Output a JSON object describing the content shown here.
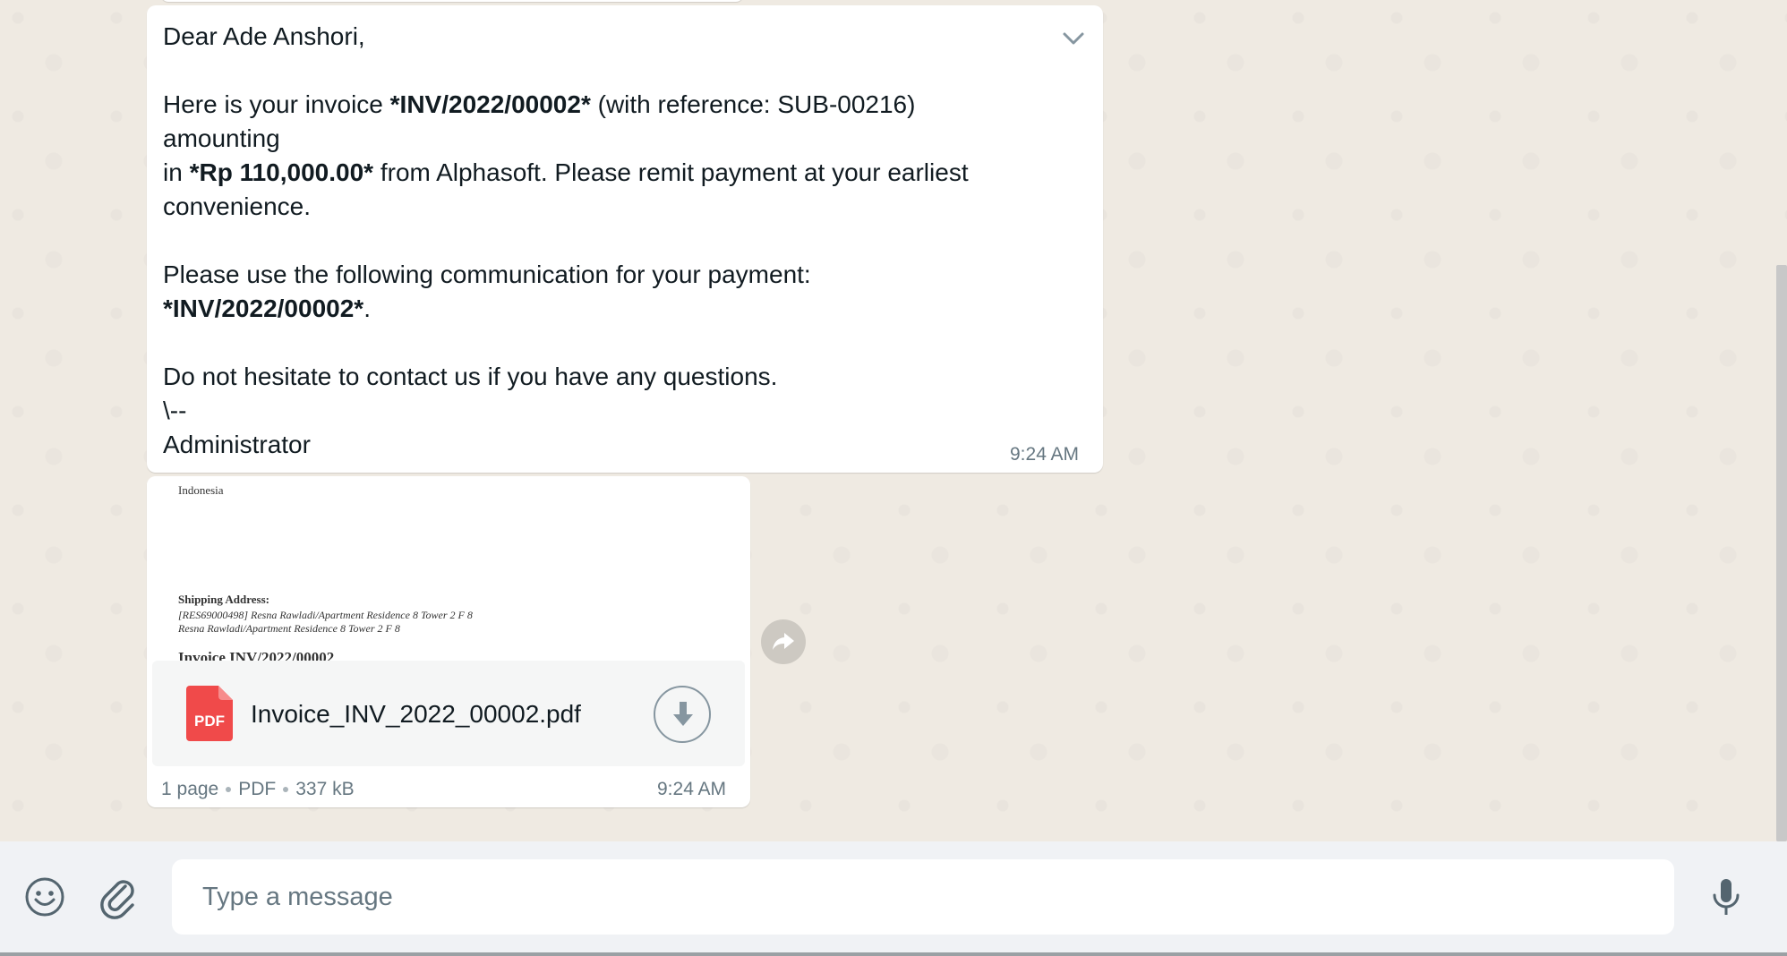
{
  "message": {
    "greeting": "Dear Ade Anshori,",
    "line1_pre": "Here is your invoice ",
    "invoice_bold": "*INV/2022/00002*",
    "line1_post": " (with reference: SUB-00216)",
    "line2": "amounting",
    "line3_pre": "in ",
    "amount_bold": "*Rp 110,000.00*",
    "line3_post": " from Alphasoft. Please remit payment at your earliest",
    "line4": "convenience.",
    "line5": "Please use the following communication for your payment:",
    "comm_bold": "*INV/2022/00002*",
    "comm_after": ".",
    "line6": "Do not hesitate to contact us if you have any questions.",
    "line7": "\\--",
    "signature": "Administrator",
    "time": "9:24 AM"
  },
  "document": {
    "preview": {
      "country": "Indonesia",
      "shipping_label": "Shipping Address:",
      "shipping_line1": "[RES69000498] Resna Rawladi/Apartment Residence 8 Tower 2 F 8",
      "shipping_line2": "Resna Rawladi/Apartment Residence 8 Tower 2 F 8",
      "invoice_heading": "Invoice INV/2022/00002"
    },
    "pdf_badge": "PDF",
    "file_name": "Invoice_INV_2022_00002.pdf",
    "pages": "1 page",
    "type": "PDF",
    "size": "337 kB",
    "time": "9:24 AM"
  },
  "compose": {
    "placeholder": "Type a message"
  },
  "icons": {
    "expand": "chevron-down-icon",
    "forward": "forward-icon",
    "download": "download-icon",
    "pdf": "pdf-file-icon",
    "emoji": "emoji-icon",
    "attach": "paperclip-icon",
    "mic": "microphone-icon"
  },
  "colors": {
    "chat_bg": "#efeae2",
    "bubble": "#ffffff",
    "pdf_red": "#f04a4a",
    "meta_text": "#667781"
  }
}
